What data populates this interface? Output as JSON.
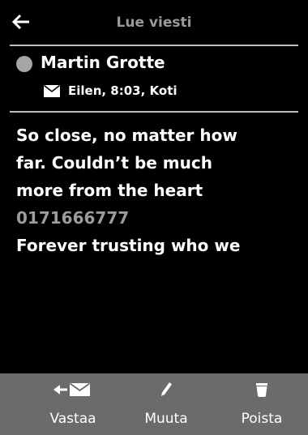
{
  "header": {
    "title": "Lue viesti"
  },
  "sender": {
    "name": "Martin Grotte"
  },
  "meta": {
    "info": "Eilen, 8:03, Koti"
  },
  "message": {
    "lines": [
      "So close, no matter how",
      "far. Couldn’t be much",
      "more from the heart",
      "0171666777",
      "Forever trusting who we"
    ]
  },
  "actions": [
    {
      "label": "Vastaa",
      "icon": "reply-mail-icon"
    },
    {
      "label": "Muuta",
      "icon": "pencil-icon"
    },
    {
      "label": "Poista",
      "icon": "trash-icon"
    }
  ],
  "colors": {
    "background": "#000000",
    "title": "#9a9a9a",
    "status_dot": "#a5a5a5",
    "number_text": "#9c9c9c",
    "bottom_bar": "#6b6b6b"
  }
}
